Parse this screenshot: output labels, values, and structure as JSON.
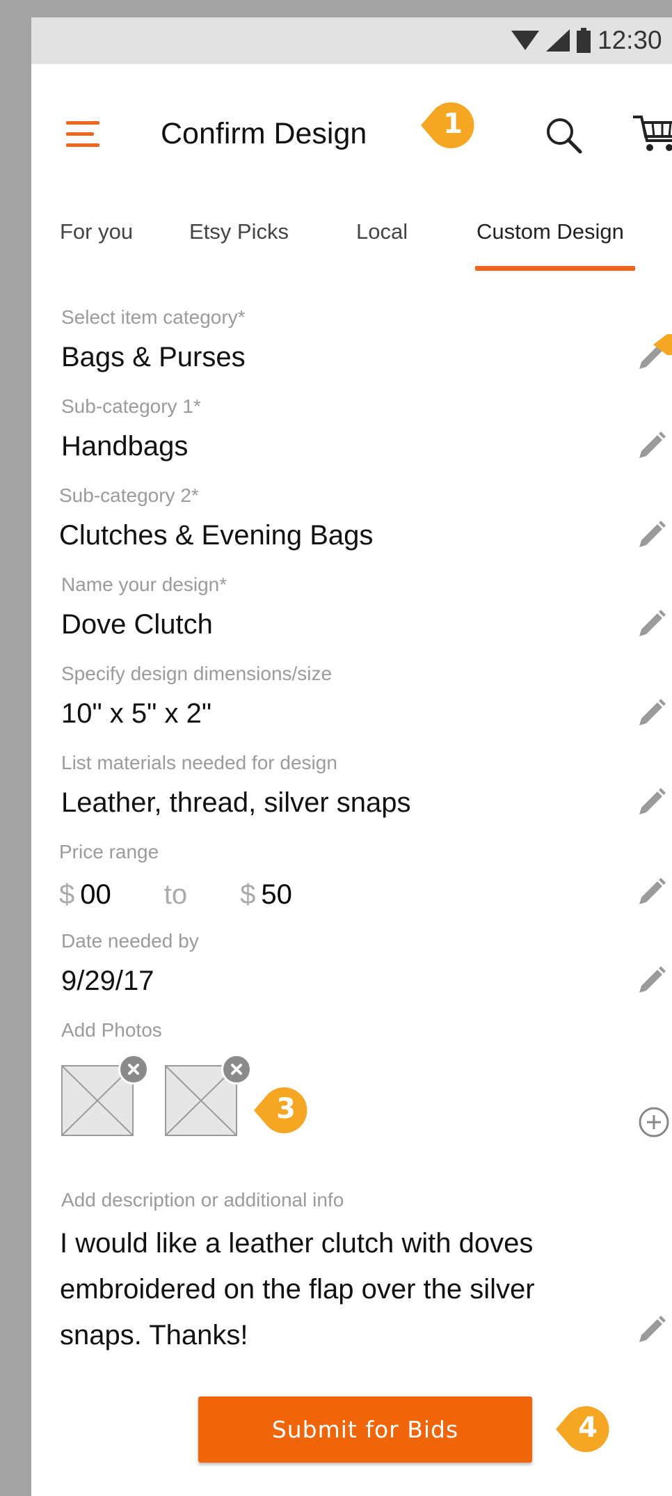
{
  "status_bar": {
    "time": "12:30"
  },
  "app_bar": {
    "title": "Confirm Design"
  },
  "tabs": [
    {
      "label": "For you"
    },
    {
      "label": "Etsy Picks"
    },
    {
      "label": "Local"
    },
    {
      "label": "Custom Design",
      "active": true
    }
  ],
  "form": {
    "category": {
      "label": "Select item category*",
      "value": "Bags & Purses"
    },
    "sub1": {
      "label": "Sub-category 1*",
      "value": "Handbags"
    },
    "sub2": {
      "label": "Sub-category 2*",
      "value": "Clutches & Evening Bags"
    },
    "name": {
      "label": "Name your design*",
      "value": "Dove Clutch"
    },
    "dimensions": {
      "label": "Specify design dimensions/size",
      "value": "10\" x 5\" x 2\""
    },
    "materials": {
      "label": "List materials needed for design",
      "value": "Leather, thread, silver snaps"
    },
    "price": {
      "label": "Price range",
      "currency": "$",
      "min": "00",
      "separator": "to",
      "max": "50"
    },
    "date": {
      "label": "Date needed by",
      "value": "9/29/17"
    },
    "photos": {
      "label": "Add Photos"
    },
    "description": {
      "label": "Add description or additional info",
      "value": "I would like a leather clutch with doves embroidered on the flap over the silver snaps. Thanks!"
    }
  },
  "submit_label": "Submit for Bids",
  "annotations": [
    "1",
    "3",
    "4"
  ],
  "colors": {
    "accent": "#f1641e",
    "button": "#f1650a",
    "callout": "#f5a623"
  }
}
